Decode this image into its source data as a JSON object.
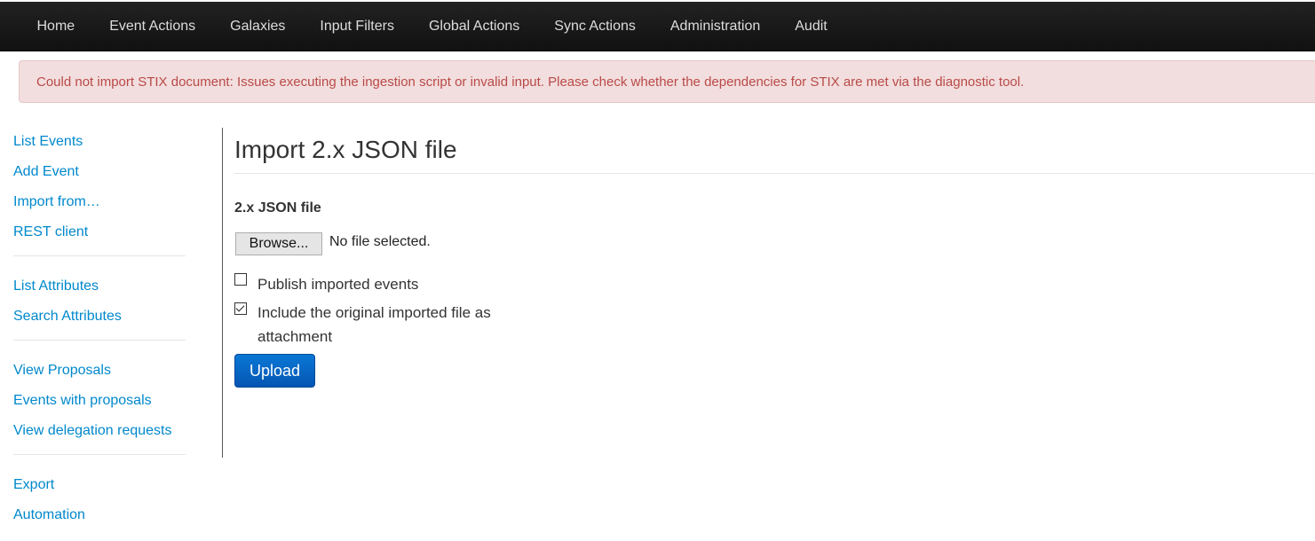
{
  "nav": {
    "items": [
      "Home",
      "Event Actions",
      "Galaxies",
      "Input Filters",
      "Global Actions",
      "Sync Actions",
      "Administration",
      "Audit"
    ]
  },
  "alert": {
    "message": "Could not import STIX document: Issues executing the ingestion script or invalid input. Please check whether the dependencies for STIX are met via the diagnostic tool."
  },
  "sidebar": {
    "groups": [
      [
        "List Events",
        "Add Event",
        "Import from…",
        "REST client"
      ],
      [
        "List Attributes",
        "Search Attributes"
      ],
      [
        "View Proposals",
        "Events with proposals",
        "View delegation requests"
      ],
      [
        "Export",
        "Automation"
      ]
    ]
  },
  "main": {
    "title": "Import 2.x JSON file",
    "file_label": "2.x JSON file",
    "browse_label": "Browse...",
    "file_status": "No file selected.",
    "checkboxes": [
      {
        "label": "Publish imported events",
        "checked": false
      },
      {
        "label_line1": "Include the original imported file as",
        "label_line2": "attachment",
        "checked": true
      }
    ],
    "upload_label": "Upload"
  },
  "colors": {
    "nav_bg": "#1a1a1a",
    "alert_bg": "#f2dede",
    "alert_text": "#b94a48",
    "link": "#0088cc",
    "primary_button": "#0a6ccb"
  }
}
